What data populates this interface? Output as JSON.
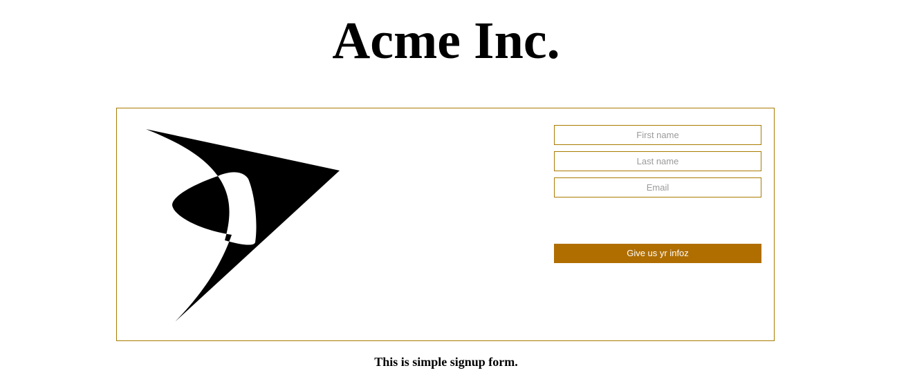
{
  "header": {
    "title": "Acme Inc."
  },
  "signup_form": {
    "logo_icon": "acme-arrow-logo-icon",
    "first_name": {
      "value": "",
      "placeholder": "First name"
    },
    "last_name": {
      "value": "",
      "placeholder": "Last name"
    },
    "email": {
      "value": "",
      "placeholder": "Email"
    },
    "submit_label": "Give us yr infoz",
    "colors": {
      "border": "#a87a00",
      "button_background": "#b06e00",
      "button_text": "#ffffff"
    }
  },
  "footer": {
    "caption": "This is simple signup form."
  }
}
